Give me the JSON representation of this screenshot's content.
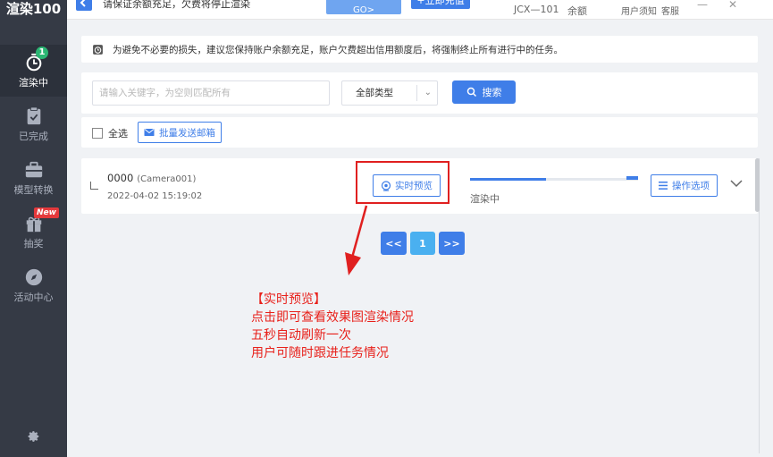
{
  "app": {
    "logo": "渲染100"
  },
  "sidebar": {
    "items": [
      {
        "label": "渲染中",
        "icon": "stopwatch-icon",
        "badge": "1",
        "active": true
      },
      {
        "label": "已完成",
        "icon": "clipboard-check-icon"
      },
      {
        "label": "模型转换",
        "icon": "briefcase-icon"
      },
      {
        "label": "抽奖",
        "icon": "gift-icon",
        "badge": "New"
      },
      {
        "label": "活动中心",
        "icon": "compass-icon"
      }
    ],
    "settings_icon": "gear-icon"
  },
  "topbar": {
    "notice": "请保证余额充足，欠费将停止渲染",
    "go_label": "GO>",
    "recharge_label": "+立即充值",
    "username": "JCX—101",
    "balance_label": "余额",
    "user_notice": "用户须知",
    "service": "客服",
    "minimize": "—",
    "close": "✕"
  },
  "notice": {
    "text": "为避免不必要的损失，建议您保持账户余额充足，账户欠费超出信用额度后，将强制终止所有进行中的任务。"
  },
  "filter": {
    "search_placeholder": "请输入关键字，为空则匹配所有",
    "type_selected": "全部类型",
    "search_label": "搜索"
  },
  "actions": {
    "select_all": "全选",
    "batch_mail": "批量发送邮箱"
  },
  "tasks": [
    {
      "id": "0000",
      "camera": "(Camera001)",
      "time": "2022-04-02 15:19:02",
      "preview_label": "实时预览",
      "progress": 0.45,
      "status": "渲染中",
      "ops_label": "操作选项"
    }
  ],
  "pager": {
    "prev": "<<",
    "current": "1",
    "next": ">>"
  },
  "annotation": {
    "title": "【实时预览】",
    "line1": "点击即可查看效果图渲染情况",
    "line2": "五秒自动刷新一次",
    "line3": "用户可随时跟进任务情况"
  },
  "colors": {
    "accent": "#3f7ee8",
    "sidebar": "#353a45",
    "annotation": "#e8201a"
  }
}
